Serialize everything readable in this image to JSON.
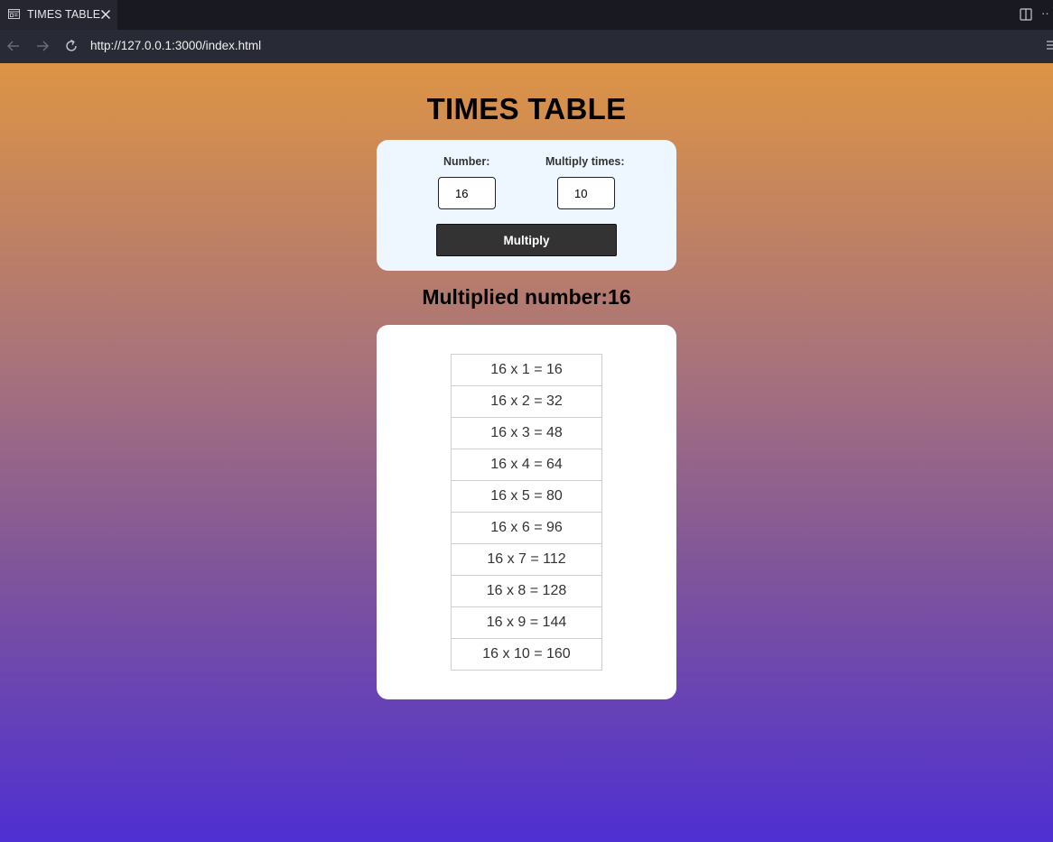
{
  "browser": {
    "tab_title": "TIMES TABLE",
    "url": "http://127.0.0.1:3000/index.html"
  },
  "page": {
    "title": "TIMES TABLE",
    "form": {
      "number_label": "Number:",
      "number_value": "16",
      "times_label": "Multiply times:",
      "times_value": "10",
      "button_label": "Multiply"
    },
    "result_heading": "Multiplied number:16",
    "rows": [
      "16 x 1 =  16",
      "16 x 2 =  32",
      "16 x 3 =  48",
      "16 x 4 =  64",
      "16 x 5 =  80",
      "16 x 6 =  96",
      "16 x 7 =  112",
      "16 x 8 =  128",
      "16 x 9 =  144",
      "16 x 10 =  160"
    ]
  },
  "colors": {
    "gradient_top": "#dd9445",
    "gradient_bottom": "#4e2fd2",
    "form_card": "#eef7ff",
    "button": "#333333"
  },
  "icons": [
    "page-icon",
    "close-icon",
    "split-editor-icon",
    "more-icon",
    "back-arrow-icon",
    "forward-arrow-icon",
    "reload-icon",
    "menu-icon"
  ]
}
